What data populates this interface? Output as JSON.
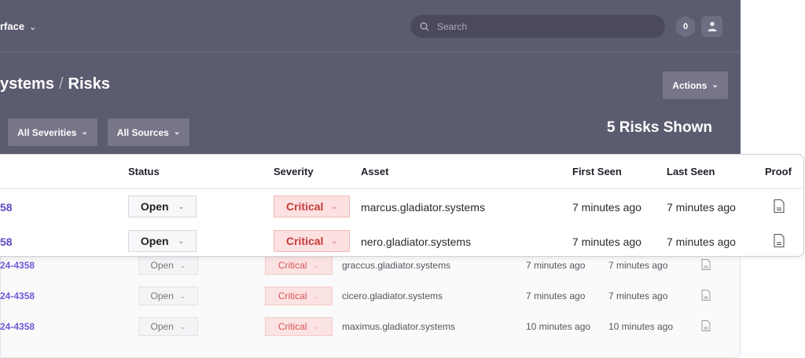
{
  "header": {
    "workspace_label": "rface",
    "search_placeholder": "Search",
    "notification_count": "0",
    "title_part1": "ystems",
    "title_sep": "/",
    "title_part2": "Risks",
    "actions_label": "Actions"
  },
  "filters": {
    "severity_label": "All Severities",
    "source_label": "All Sources",
    "count_text": "5 Risks Shown"
  },
  "table": {
    "columns": [
      "Status",
      "Severity",
      "Asset",
      "First Seen",
      "Last Seen",
      "Proof"
    ],
    "rows": [
      {
        "id": "58",
        "status": "Open",
        "severity": "Critical",
        "asset": "marcus.gladiator.systems",
        "first_seen": "7 minutes ago",
        "last_seen": "7 minutes ago"
      },
      {
        "id": "58",
        "status": "Open",
        "severity": "Critical",
        "asset": "nero.gladiator.systems",
        "first_seen": "7 minutes ago",
        "last_seen": "7 minutes ago"
      },
      {
        "id": "24-4358",
        "status": "Open",
        "severity": "Critical",
        "asset": "graccus.gladiator.systems",
        "first_seen": "7 minutes ago",
        "last_seen": "7 minutes ago"
      },
      {
        "id": "24-4358",
        "status": "Open",
        "severity": "Critical",
        "asset": "cicero.gladiator.systems",
        "first_seen": "7 minutes ago",
        "last_seen": "7 minutes ago"
      },
      {
        "id": "24-4358",
        "status": "Open",
        "severity": "Critical",
        "asset": "maximus.gladiator.systems",
        "first_seen": "10 minutes ago",
        "last_seen": "10 minutes ago"
      }
    ]
  },
  "colors": {
    "panel_bg": "#5c5c70",
    "accent_id": "#5b4bc4",
    "critical_text": "#c43c3c",
    "critical_bg": "#fde0e0"
  },
  "icons": [
    "chevron-down-icon",
    "search-icon",
    "notification-hex-icon",
    "user-icon",
    "document-icon"
  ]
}
